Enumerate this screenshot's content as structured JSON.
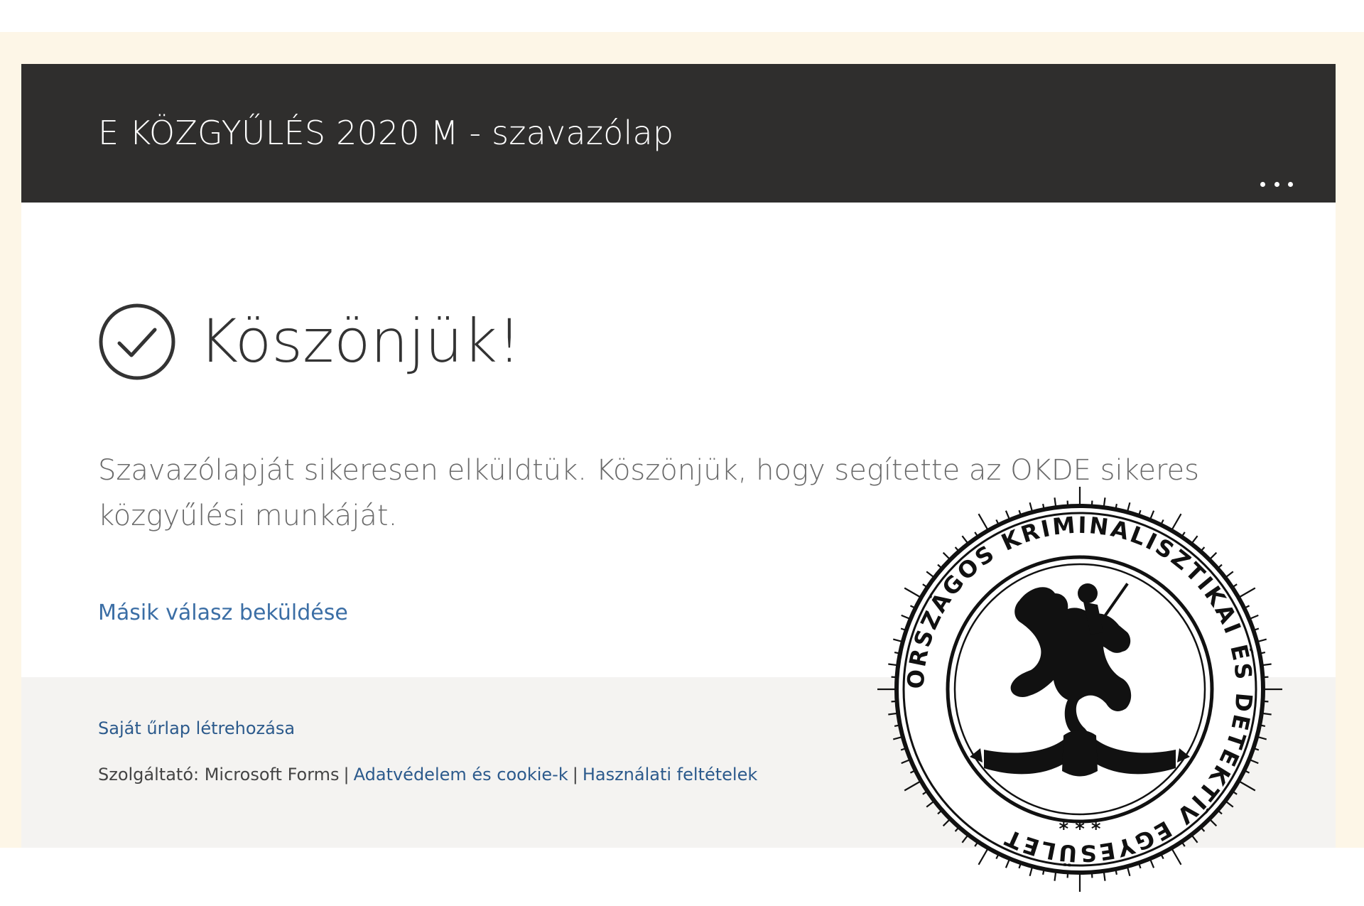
{
  "form": {
    "title": "E KÖZGYŰLÉS 2020 M - szavazólap"
  },
  "confirmation": {
    "heading": "Köszönjük!",
    "message": "Szavazólapját sikeresen elküldtük. Köszönjük, hogy segítette az OKDE sikeres közgyűlési munkáját.",
    "another_response_link": "Másik válasz beküldése"
  },
  "footer": {
    "create_form_link": "Saját űrlap létrehozása",
    "provider_text": "Szolgáltató: Microsoft Forms",
    "separator": "|",
    "privacy_link": "Adatvédelem és cookie-k",
    "terms_link": "Használati feltételek"
  },
  "seal": {
    "text": "ORSZÁGOS KRIMINALISZTIKAI ÉS DETEKTÍV EGYESÜLET",
    "stars": "* * *"
  },
  "icons": {
    "more": "more-options-icon",
    "check": "check-circle-icon"
  },
  "colors": {
    "header_bg": "#2f2e2d",
    "link": "#3b6ea5",
    "footer_bg": "#f4f3f1",
    "frame_bg": "#fdf6e7"
  }
}
